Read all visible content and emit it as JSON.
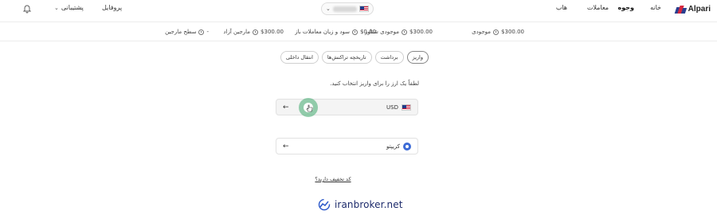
{
  "header": {
    "brand": "Alpari",
    "nav": [
      "خانه",
      "وجوه",
      "معاملات",
      "هاب"
    ],
    "active_nav": "وجوه",
    "profile_label": "پروفایل",
    "support_label": "پشتیبانی"
  },
  "stats": [
    {
      "label": "موجودی",
      "value": "$300.00"
    },
    {
      "label": "موجودی شناور",
      "value": "$300.00"
    },
    {
      "label": "سود و زیان معاملات باز",
      "value": "$0.00"
    },
    {
      "label": "مارجین آزاد",
      "value": "$300.00"
    },
    {
      "label": "سطح مارجین",
      "value": "-"
    }
  ],
  "tabs": [
    {
      "label": "واریز",
      "active": true
    },
    {
      "label": "برداشت",
      "active": false
    },
    {
      "label": "تاریخچه تراکنش‌ها",
      "active": false
    },
    {
      "label": "انتقال داخلی",
      "active": false
    }
  ],
  "deposit": {
    "prompt": "لطفاً یک ارز را برای واریز انتخاب کنید.",
    "options": [
      {
        "label": "USD",
        "icon": "us-flag-icon"
      },
      {
        "label": "کریپتو",
        "icon": "crypto-icon"
      }
    ],
    "coupon_link": "کد تخفیف دارید؟"
  },
  "watermark": "iranbroker.net",
  "colors": {
    "brand_red": "#d6283f",
    "brand_blue": "#2a3f8f",
    "click_highlight": "#40aa6e",
    "watermark_blue": "#1c2a6b"
  }
}
